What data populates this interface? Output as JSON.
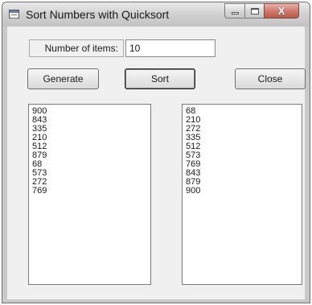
{
  "window": {
    "title": "Sort Numbers with Quicksort",
    "caption_close": "X"
  },
  "form": {
    "items_label": "Number of items:",
    "items_value": "10"
  },
  "buttons": {
    "generate": "Generate",
    "sort": "Sort",
    "close": "Close"
  },
  "unsorted_list": [
    "900",
    "843",
    "335",
    "210",
    "512",
    "879",
    "68",
    "573",
    "272",
    "769"
  ],
  "sorted_list": [
    "68",
    "210",
    "272",
    "335",
    "512",
    "573",
    "769",
    "843",
    "879",
    "900"
  ]
}
